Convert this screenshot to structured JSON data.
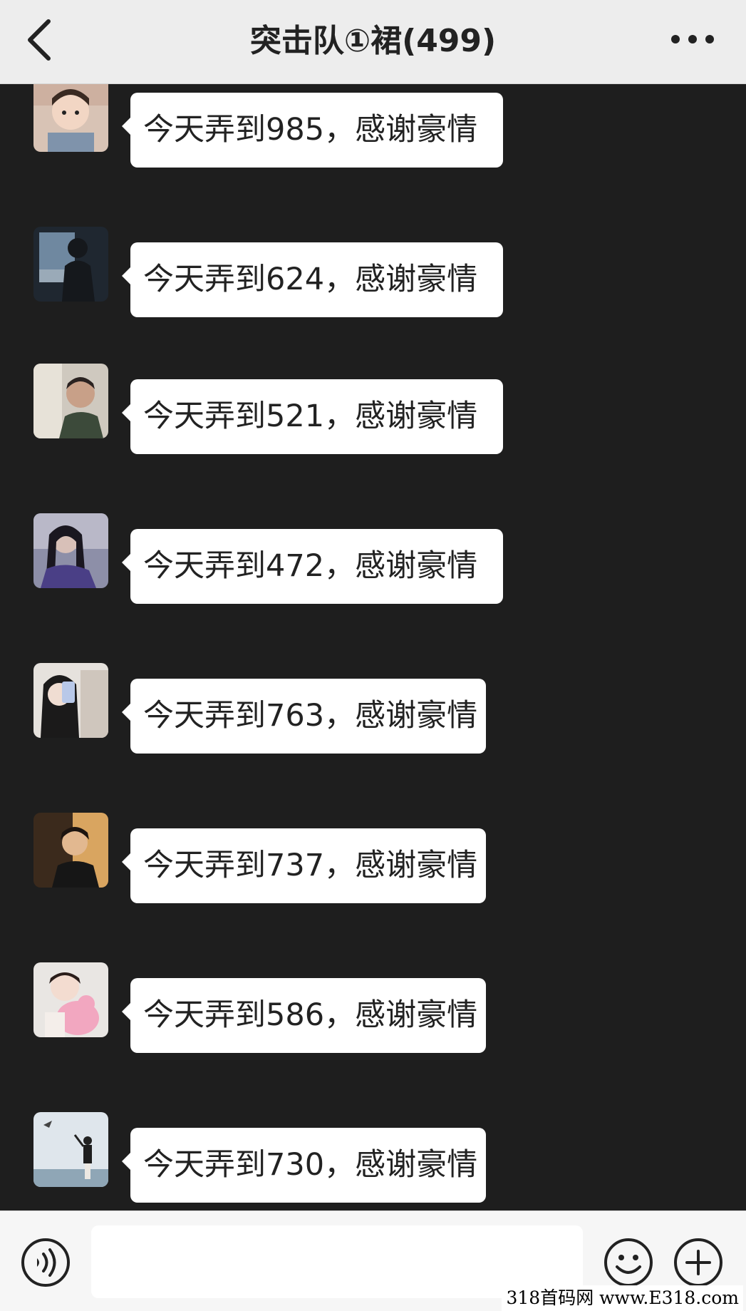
{
  "header": {
    "title": "突击队①裙(499)",
    "back_icon": "chevron-left-icon",
    "more_icon": "more-dots-icon"
  },
  "messages": [
    {
      "text": "今天弄到985，感谢豪情",
      "avatar": "toddler-photo"
    },
    {
      "text": "今天弄到624，感谢豪情",
      "avatar": "silhouette-by-window"
    },
    {
      "text": "今天弄到521，感谢豪情",
      "avatar": "man-portrait"
    },
    {
      "text": "今天弄到472，感谢豪情",
      "avatar": "woman-long-hair"
    },
    {
      "text": "今天弄到763，感谢豪情",
      "avatar": "girl-phone-selfie"
    },
    {
      "text": "今天弄到737，感谢豪情",
      "avatar": "man-suit-warm-light"
    },
    {
      "text": "今天弄到586，感谢豪情",
      "avatar": "baby-pink-plush"
    },
    {
      "text": "今天弄到730，感谢豪情",
      "avatar": "person-at-seaside"
    }
  ],
  "input_bar": {
    "voice_icon": "voice-icon",
    "placeholder": "",
    "emoji_icon": "emoji-icon",
    "plus_icon": "plus-icon"
  },
  "watermark": "318首码网 www.E318.com",
  "colors": {
    "background": "#1e1e1e",
    "header": "#ededed",
    "bubble": "#ffffff",
    "input_bar": "#f6f6f6"
  }
}
